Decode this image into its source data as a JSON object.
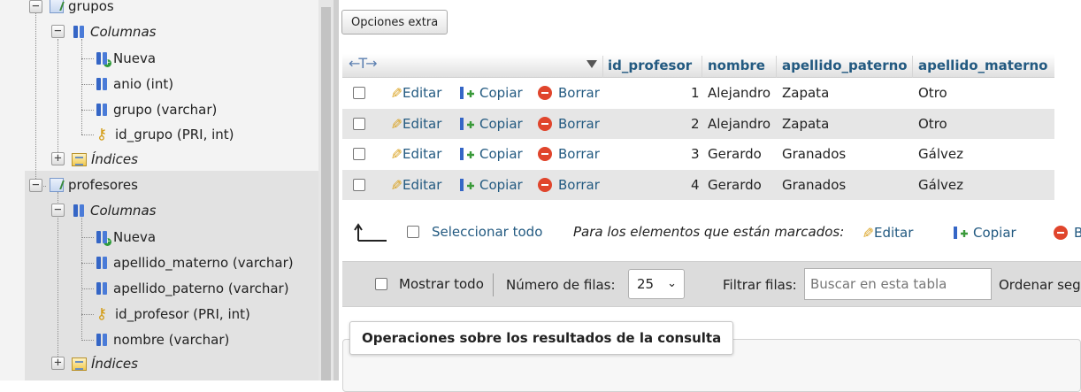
{
  "nav": {
    "tree": [
      {
        "label": "grupos",
        "icon": "table-icon",
        "toggle": "−"
      },
      {
        "label": "Columnas",
        "icon": "columns-icon",
        "toggle": "−"
      },
      {
        "label": "Nueva",
        "icon": "new-column-icon"
      },
      {
        "label": "anio (int)",
        "icon": "column-icon"
      },
      {
        "label": "grupo (varchar)",
        "icon": "column-icon"
      },
      {
        "label": "id_grupo (PRI, int)",
        "icon": "primary-key-icon"
      },
      {
        "label": "Índices",
        "icon": "indexes-icon",
        "toggle": "+"
      },
      {
        "label": "profesores",
        "icon": "table-icon",
        "toggle": "−"
      },
      {
        "label": "Columnas",
        "icon": "columns-icon",
        "toggle": "−"
      },
      {
        "label": "Nueva",
        "icon": "new-column-icon"
      },
      {
        "label": "apellido_materno (varchar)",
        "icon": "column-icon"
      },
      {
        "label": "apellido_paterno (varchar)",
        "icon": "column-icon"
      },
      {
        "label": "id_profesor (PRI, int)",
        "icon": "primary-key-icon"
      },
      {
        "label": "nombre (varchar)",
        "icon": "column-icon"
      },
      {
        "label": "Índices",
        "icon": "indexes-icon",
        "toggle": "+"
      }
    ]
  },
  "toolbar": {
    "extra_options": "Opciones extra"
  },
  "table": {
    "arrows": "←T→",
    "columns": [
      "id_profesor",
      "nombre",
      "apellido_paterno",
      "apellido_materno"
    ],
    "actions": {
      "edit": "Editar",
      "copy": "Copiar",
      "delete": "Borrar"
    },
    "rows": [
      {
        "id": "1",
        "nombre": "Alejandro",
        "paterno": "Zapata",
        "materno": "Otro"
      },
      {
        "id": "2",
        "nombre": "Alejandro",
        "paterno": "Zapata",
        "materno": "Otro"
      },
      {
        "id": "3",
        "nombre": "Gerardo",
        "paterno": "Granados",
        "materno": "Gálvez"
      },
      {
        "id": "4",
        "nombre": "Gerardo",
        "paterno": "Granados",
        "materno": "Gálvez"
      }
    ]
  },
  "bulk": {
    "select_all": "Seleccionar todo",
    "marked_label": "Para los elementos que están marcados:",
    "edit": "Editar",
    "copy": "Copiar",
    "delete": "B"
  },
  "navigation": {
    "show_all": "Mostrar todo",
    "rows_label": "Número de filas:",
    "rows_value": "25",
    "filter_label": "Filtrar filas:",
    "filter_placeholder": "Buscar en esta tabla",
    "sort_label": "Ordenar segu"
  },
  "operations": {
    "title": "Operaciones sobre los resultados de la consulta"
  },
  "colors": {
    "link": "#235a81",
    "row_alt": "#e6e6e6",
    "delete": "#e0452c",
    "key": "#d39b12"
  }
}
